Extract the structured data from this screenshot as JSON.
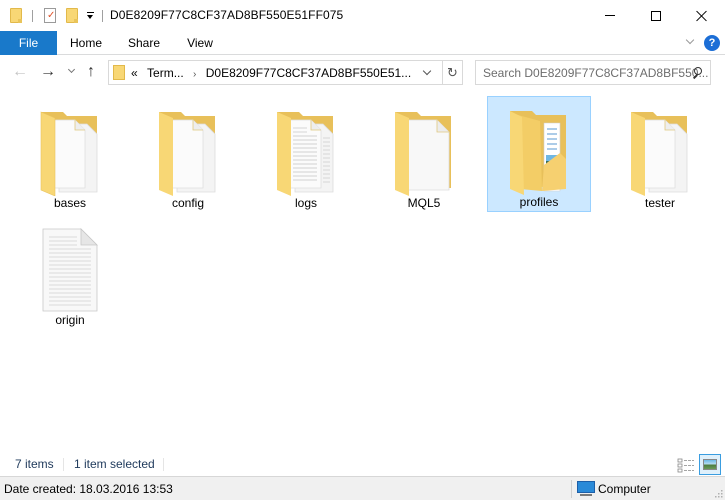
{
  "window": {
    "title": "D0E8209F77C8CF37AD8BF550E51FF075",
    "controls": {
      "minimize": "minimize-icon",
      "maximize": "maximize-icon",
      "close": "close-icon"
    }
  },
  "quick_access": [
    {
      "icon": "folder-icon"
    },
    {
      "icon": "properties-icon",
      "glyph": "✓"
    },
    {
      "icon": "new-folder-icon"
    },
    {
      "icon": "customize-dropdown-icon"
    }
  ],
  "ribbon": {
    "tabs": [
      {
        "label": "File",
        "active": true
      },
      {
        "label": "Home"
      },
      {
        "label": "Share"
      },
      {
        "label": "View"
      }
    ],
    "help_glyph": "?"
  },
  "navigation": {
    "back_glyph": "←",
    "forward_glyph": "→",
    "up_glyph": "↑",
    "address": {
      "overflow": "«",
      "segments": [
        "Term...",
        "D0E8209F77C8CF37AD8BF550E51..."
      ],
      "separator": "›"
    },
    "refresh_glyph": "↻",
    "search": {
      "placeholder": "Search D0E8209F77C8CF37AD8BF550..."
    }
  },
  "items": [
    {
      "name": "bases",
      "type": "folder",
      "variant": "docs",
      "selected": false
    },
    {
      "name": "config",
      "type": "folder",
      "variant": "docs",
      "selected": false
    },
    {
      "name": "logs",
      "type": "folder",
      "variant": "text",
      "selected": false
    },
    {
      "name": "MQL5",
      "type": "folder",
      "variant": "single",
      "selected": false
    },
    {
      "name": "profiles",
      "type": "folder",
      "variant": "image",
      "selected": true
    },
    {
      "name": "tester",
      "type": "folder",
      "variant": "docs",
      "selected": false
    },
    {
      "name": "origin",
      "type": "file",
      "variant": "text",
      "selected": false
    }
  ],
  "status": {
    "item_count": "7 items",
    "selection": "1 item selected"
  },
  "info": {
    "date_created": "Date created: 18.03.2016 13:53",
    "location": "Computer"
  },
  "colors": {
    "accent": "#1979ca",
    "selection_bg": "#cce8ff",
    "selection_border": "#99d1ff",
    "folder_yellow": "#f8d775"
  }
}
